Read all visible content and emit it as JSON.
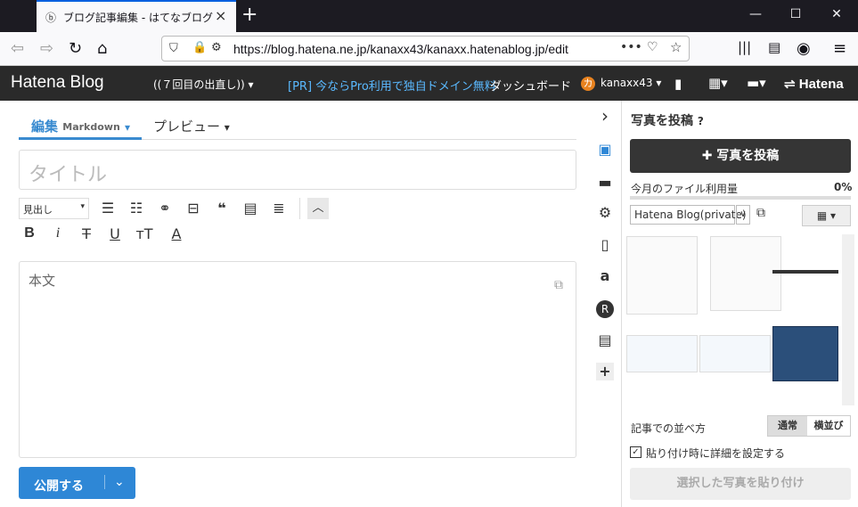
{
  "browser": {
    "tab_title": "ブログ記事編集 - はてなブログ",
    "url": "https://blog.hatena.ne.jp/kanaxx43/kanaxx.hatenablog.jp/edit"
  },
  "header": {
    "logo": "Hatena Blog",
    "blog_select": "((７回目の出直し))",
    "promo": "[PR] 今ならPro利用で独自ドメイン無料",
    "dashboard": "ダッシュボード",
    "user_initial": "カ",
    "username": "kanaxx43",
    "hatena": "Hatena"
  },
  "editor": {
    "tab_edit": "編集",
    "tab_edit_mode": "Markdown",
    "tab_preview": "プレビュー",
    "title_placeholder": "タイトル",
    "heading_select": "見出し",
    "body_placeholder": "本文",
    "publish": "公開する"
  },
  "panel": {
    "title": "写真を投稿",
    "upload": "写真を投稿",
    "usage_label": "今月のファイル利用量",
    "usage_value": "0%",
    "album": "Hatena Blog(private)",
    "sort_label": "記事での並べ方",
    "sort_normal": "通常",
    "sort_horizontal": "横並び",
    "checkbox_label": "貼り付け時に詳細を設定する",
    "paste": "選択した写真を貼り付け"
  }
}
